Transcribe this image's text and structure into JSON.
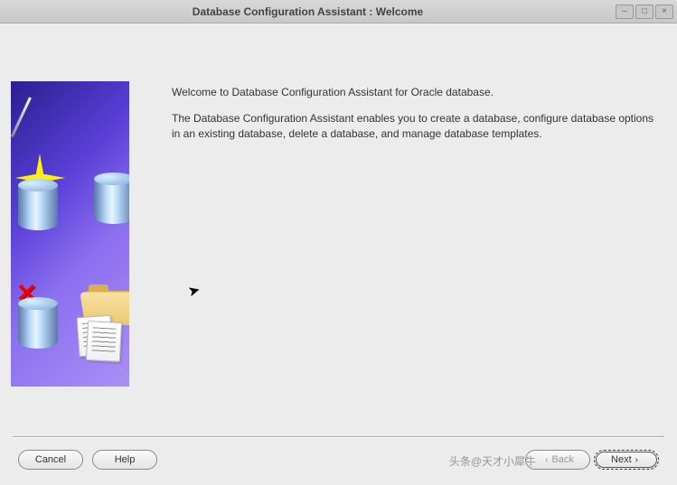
{
  "window": {
    "title": "Database Configuration Assistant : Welcome"
  },
  "content": {
    "intro": "Welcome to Database Configuration Assistant for Oracle database.",
    "description": "The Database Configuration Assistant enables you to create a database, configure database options in an existing database, delete a database, and manage database templates."
  },
  "buttons": {
    "cancel": "Cancel",
    "help": "Help",
    "back": "Back",
    "next": "Next"
  },
  "watermark": "头条@天才小犀牛"
}
